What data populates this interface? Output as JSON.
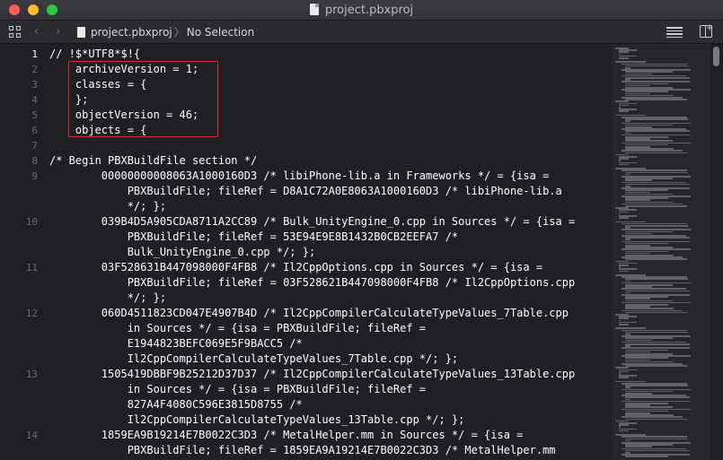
{
  "window": {
    "title": "project.pbxproj"
  },
  "toolbar": {
    "file_crumb": "project.pbxproj",
    "selection_crumb": "No Selection"
  },
  "editor": {
    "line_numbers": [
      "1",
      "2",
      "3",
      "4",
      "5",
      "6",
      "7",
      "8",
      "9",
      "10",
      "11",
      "12",
      "13",
      "14"
    ],
    "code_lines": [
      "// !$*UTF8*$!{",
      "    archiveVersion = 1;",
      "    classes = {",
      "    };",
      "    objectVersion = 46;",
      "    objects = {",
      "",
      "/* Begin PBXBuildFile section */",
      "        00000000008063A1000160D3 /* libiPhone-lib.a in Frameworks */ = {isa =",
      "            PBXBuildFile; fileRef = D8A1C72A0E8063A1000160D3 /* libiPhone-lib.a",
      "            */; };",
      "        039B4D5A905CDA8711A2CC89 /* Bulk_UnityEngine_0.cpp in Sources */ = {isa =",
      "            PBXBuildFile; fileRef = 53E94E9E8B1432B0CB2EEFA7 /*",
      "            Bulk_UnityEngine_0.cpp */; };",
      "        03F528631B447098000F4FB8 /* Il2CppOptions.cpp in Sources */ = {isa =",
      "            PBXBuildFile; fileRef = 03F528621B447098000F4FB8 /* Il2CppOptions.cpp",
      "            */; };",
      "        060D4511823CD047E4907B4D /* Il2CppCompilerCalculateTypeValues_7Table.cpp",
      "            in Sources */ = {isa = PBXBuildFile; fileRef =",
      "            E1944823BEFC069E5F9BACC5 /*",
      "            Il2CppCompilerCalculateTypeValues_7Table.cpp */; };",
      "        1505419DBBF9B25212D37D37 /* Il2CppCompilerCalculateTypeValues_13Table.cpp",
      "            in Sources */ = {isa = PBXBuildFile; fileRef =",
      "            827A4F4080C596E3815D8755 /*",
      "            Il2CppCompilerCalculateTypeValues_13Table.cpp */; };",
      "        1859EA9B19214E7B0022C3D3 /* MetalHelper.mm in Sources */ = {isa =",
      "            PBXBuildFile; fileRef = 1859EA9A19214E7B0022C3D3 /* MetalHelper.mm"
    ]
  },
  "icons": {
    "window_controls": [
      "close-icon",
      "minimize-icon",
      "zoom-icon"
    ],
    "toolbar": [
      "related-items-grid-icon",
      "back-chevron-icon",
      "forward-chevron-icon",
      "file-icon",
      "editor-options-lines-icon",
      "add-editor-split-icon"
    ]
  },
  "colors": {
    "background": "#1f1f24",
    "text": "#ffffff",
    "line_number": "#6b6b70",
    "highlight_box": "#d42a2a",
    "close": "#fe5f57",
    "minimize": "#febc2e",
    "zoom": "#28c840"
  }
}
